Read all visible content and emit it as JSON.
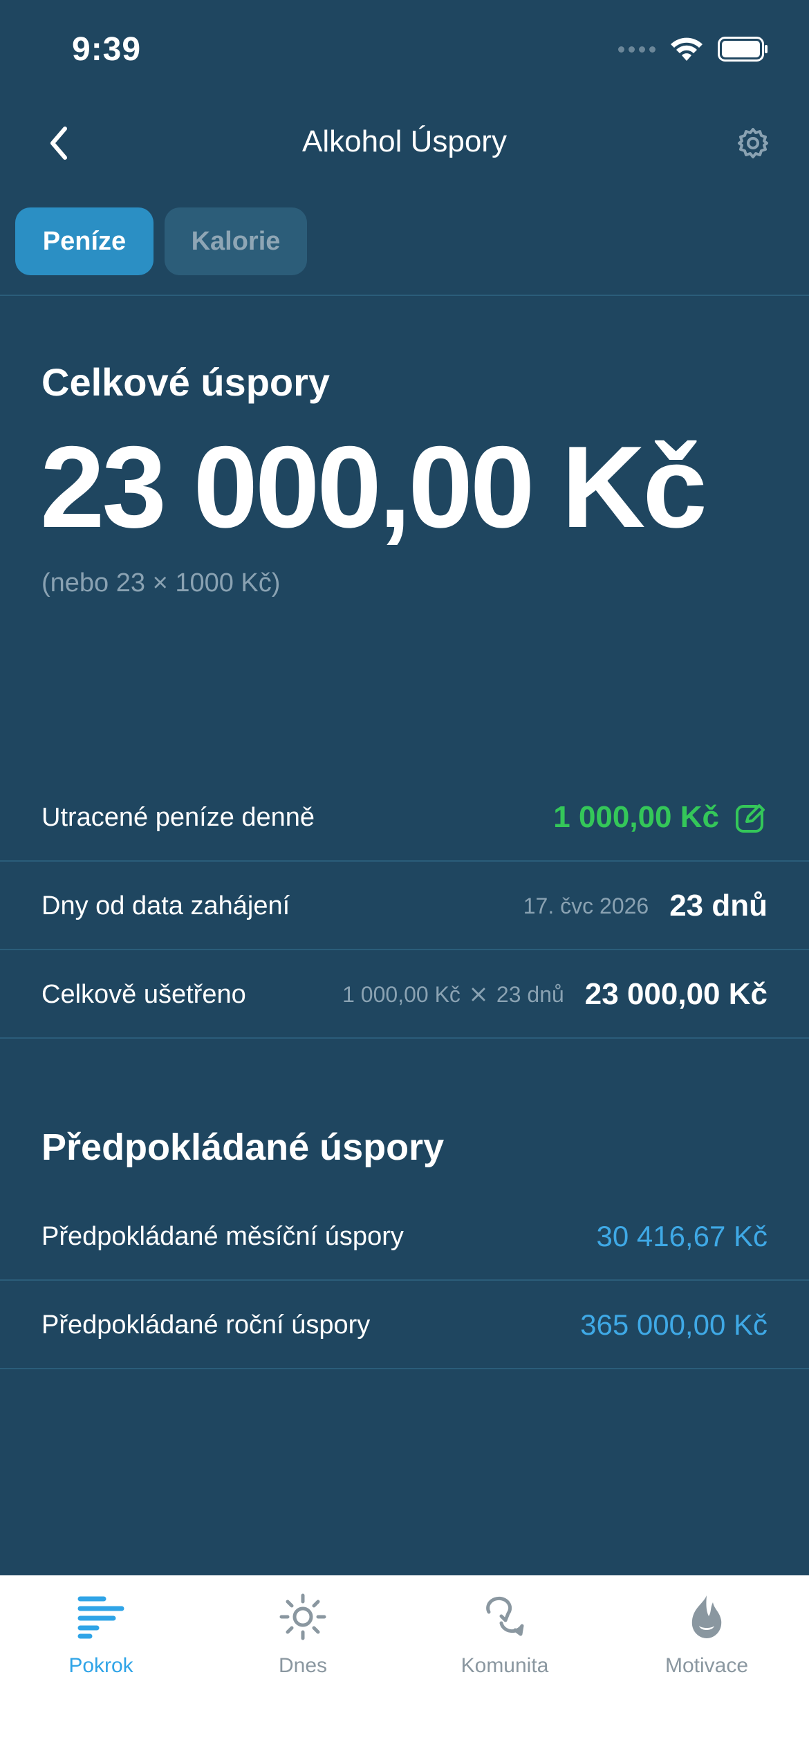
{
  "status_bar": {
    "time": "9:39"
  },
  "nav": {
    "title": "Alkohol Úspory"
  },
  "segments": {
    "money": "Peníze",
    "calories": "Kalorie"
  },
  "total": {
    "label": "Celkové úspory",
    "value": "23 000,00 Kč",
    "subtitle": "(nebo 23 × 1000 Kč)"
  },
  "rows": {
    "daily": {
      "label": "Utracené peníze denně",
      "value": "1 000,00 Kč"
    },
    "days": {
      "label": "Dny od data zahájení",
      "date": "17. čvc 2026",
      "value": "23 dnů"
    },
    "saved": {
      "label": "Celkově ušetřeno",
      "daily": "1 000,00 Kč",
      "days": "23 dnů",
      "value": "23 000,00 Kč"
    }
  },
  "projected": {
    "title": "Předpokládané úspory",
    "monthly": {
      "label": "Předpokládané měsíční úspory",
      "value": "30 416,67 Kč"
    },
    "yearly": {
      "label": "Předpokládané roční úspory",
      "value": "365 000,00 Kč"
    }
  },
  "tabs": [
    {
      "label": "Pokrok",
      "active": true
    },
    {
      "label": "Dnes",
      "active": false
    },
    {
      "label": "Komunita",
      "active": false
    },
    {
      "label": "Motivace",
      "active": false
    }
  ],
  "colors": {
    "background": "#1f4660",
    "accent": "#2b8fc4",
    "green": "#34c759",
    "blue_value": "#3fa9e6",
    "tab_active": "#2fa4e7"
  }
}
